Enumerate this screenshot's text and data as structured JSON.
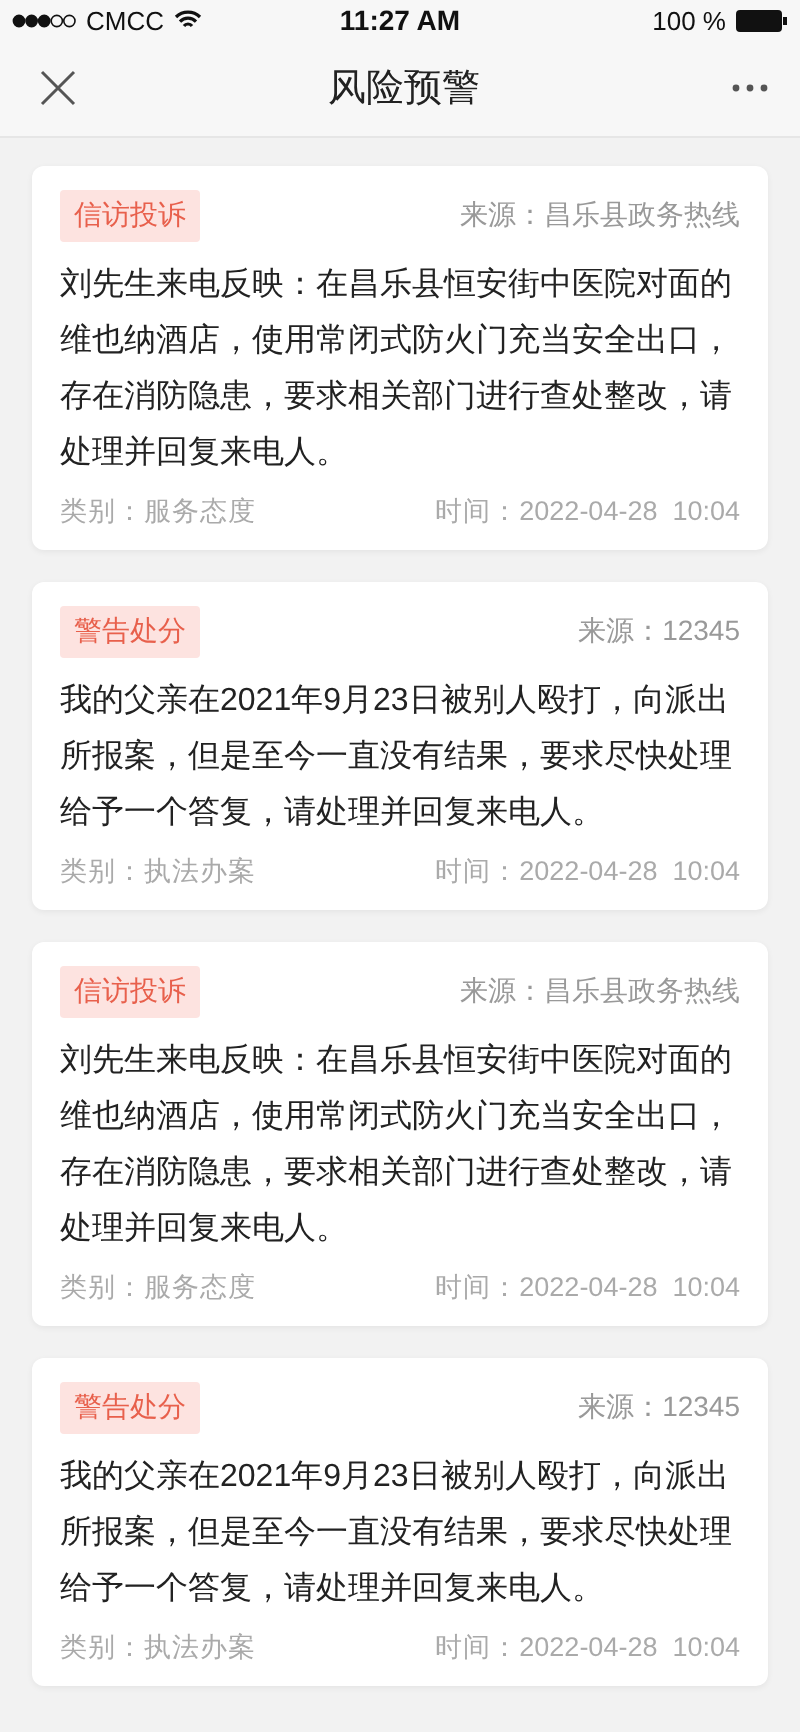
{
  "status_bar": {
    "carrier": "CMCC",
    "time": "11:27 AM",
    "battery": "100 %"
  },
  "nav_bar": {
    "title": "风险预警"
  },
  "cards": [
    {
      "tag": "信访投诉",
      "source": "来源：昌乐县政务热线",
      "content": "刘先生来电反映：在昌乐县恒安街中医院对面的维也纳酒店，使用常闭式防火门充当安全出口，存在消防隐患，要求相关部门进行查处整改，请处理并回复来电人。",
      "category": "类别：服务态度",
      "time": "时间：2022-04-28  10:04"
    },
    {
      "tag": "警告处分",
      "source": "来源：12345",
      "content": "我的父亲在2021年9月23日被别人殴打，向派出所报案，但是至今一直没有结果，要求尽快处理给予一个答复，请处理并回复来电人。",
      "category": "类别：执法办案",
      "time": "时间：2022-04-28  10:04"
    },
    {
      "tag": "信访投诉",
      "source": "来源：昌乐县政务热线",
      "content": "刘先生来电反映：在昌乐县恒安街中医院对面的维也纳酒店，使用常闭式防火门充当安全出口，存在消防隐患，要求相关部门进行查处整改，请处理并回复来电人。",
      "category": "类别：服务态度",
      "time": "时间：2022-04-28  10:04"
    },
    {
      "tag": "警告处分",
      "source": "来源：12345",
      "content": "我的父亲在2021年9月23日被别人殴打，向派出所报案，但是至今一直没有结果，要求尽快处理给予一个答复，请处理并回复来电人。",
      "category": "类别：执法办案",
      "time": "时间：2022-04-28  10:04"
    }
  ]
}
